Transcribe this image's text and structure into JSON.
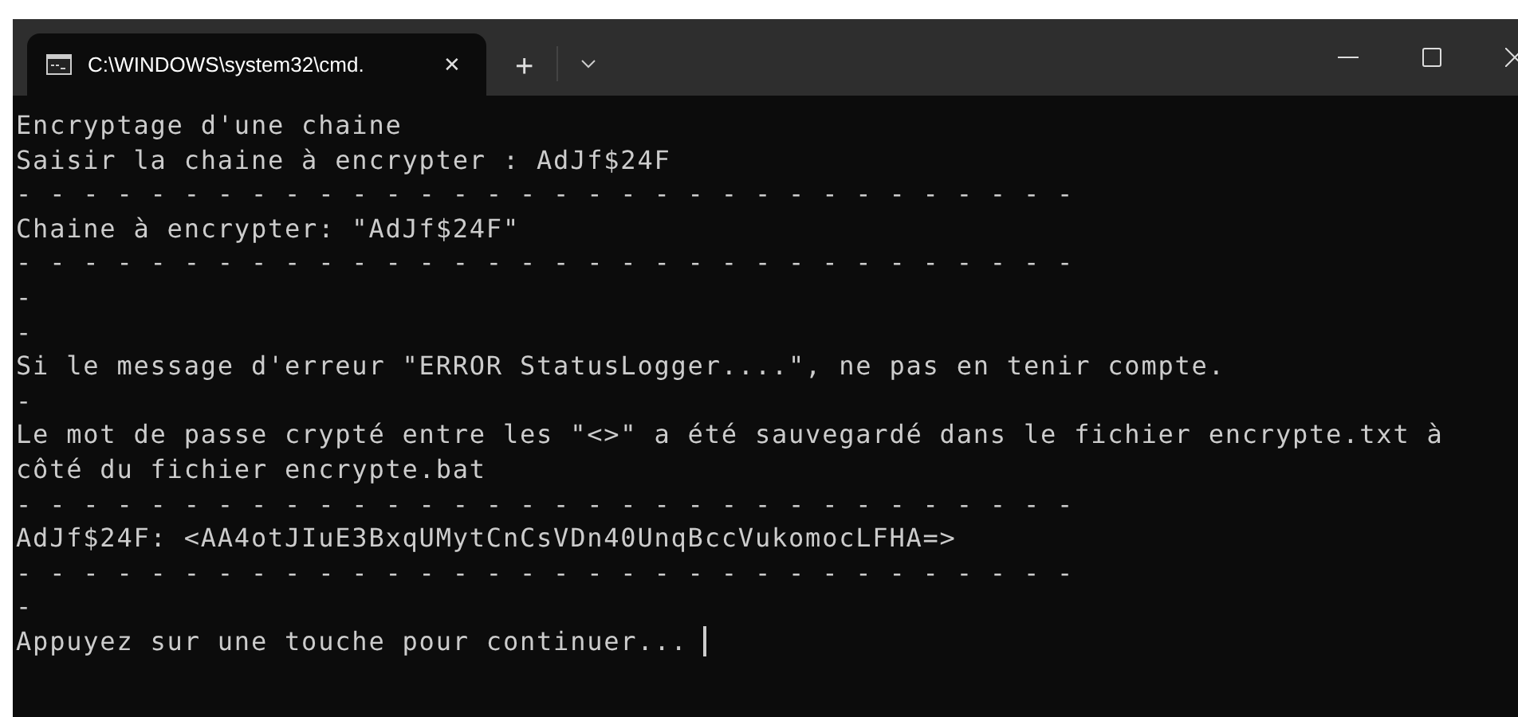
{
  "tab": {
    "title": "C:\\WINDOWS\\system32\\cmd.",
    "close": "✕",
    "selected": true
  },
  "new_tab": "+",
  "lines": [
    "Encryptage d'une chaine",
    "Saisir la chaine à encrypter : AdJf$24F",
    "- - - - - - - - - - - - - - - - - - - - - - - - - - - - - - - -",
    "Chaine à encrypter: \"AdJf$24F\"",
    "- - - - - - - - - - - - - - - - - - - - - - - - - - - - - - - -",
    "-",
    "-",
    "Si le message d'erreur \"ERROR StatusLogger....\", ne pas en tenir compte.",
    "-",
    "Le mot de passe crypté entre les \"<>\" a été sauvegardé dans le fichier encrypte.txt à",
    "côté du fichier encrypte.bat",
    "- - - - - - - - - - - - - - - - - - - - - - - - - - - - - - - -",
    "AdJf$24F: <AA4otJIuE3BxqUMytCnCsVDn40UnqBccVukomocLFHA=>",
    "- - - - - - - - - - - - - - - - - - - - - - - - - - - - - - - -",
    "-",
    "Appuyez sur une touche pour continuer..."
  ]
}
